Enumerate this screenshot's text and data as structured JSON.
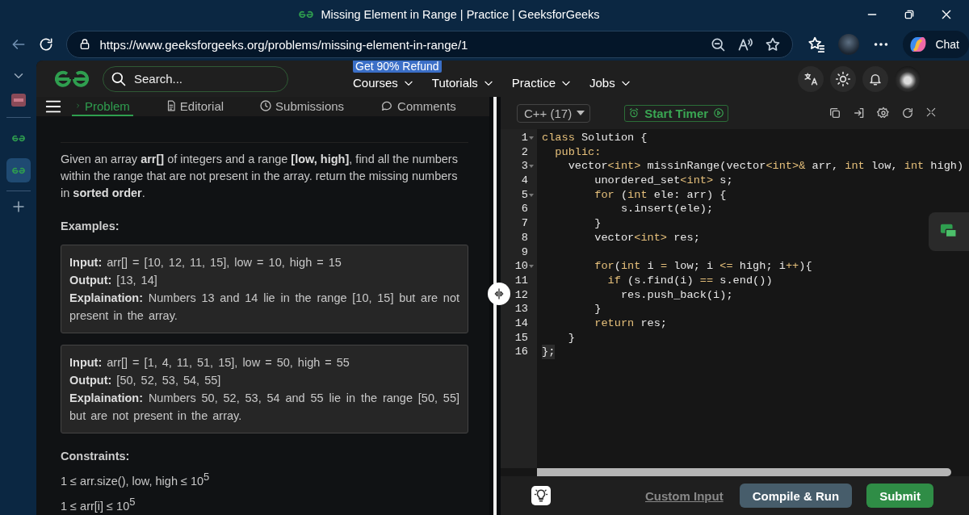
{
  "browser": {
    "tab_title": "Missing Element in Range | Practice | GeeksforGeeks",
    "url": "https://www.geeksforgeeks.org/problems/missing-element-in-range/1",
    "chat_label": "Chat"
  },
  "header": {
    "search_placeholder": "Search...",
    "promo_badge": "Get 90% Refund",
    "nav": [
      {
        "label": "Courses"
      },
      {
        "label": "Tutorials"
      },
      {
        "label": "Practice"
      },
      {
        "label": "Jobs"
      }
    ]
  },
  "problem_tabs": [
    {
      "label": "Problem",
      "selected": true
    },
    {
      "label": "Editorial",
      "selected": false
    },
    {
      "label": "Submissions",
      "selected": false
    },
    {
      "label": "Comments",
      "selected": false
    }
  ],
  "problem": {
    "description": "Given an array **arr[]** of integers and a range **[low, high]**, find all the numbers within the range that are not present in the array. return the missing numbers in **sorted order**.",
    "examples_heading": "Examples:",
    "examples": [
      {
        "lines": [
          "**Input:** arr[] = [10, 12, 11, 15], low = 10, high = 15",
          "**Output:** [13, 14]",
          "**Explaination:** Numbers 13 and 14 lie in the range [10, 15] but are not present in the array."
        ]
      },
      {
        "lines": [
          "**Input:** arr[] = [1, 4, 11, 51, 15], low = 50, high = 55",
          "**Output:** [50, 52, 53, 54, 55]",
          "**Explaination:** Numbers 50, 52, 53, 54 and 55 lie in the range [50, 55] but are not present in the array."
        ]
      }
    ],
    "constraints_heading": "Constraints:",
    "constraints": [
      "1 ≤ arr.size(), low, high ≤ 10$^{5}$",
      "1 ≤ arr[i] ≤ 10$^{5}$"
    ]
  },
  "editor": {
    "language": "C++ (17)",
    "timer_label": "Start Timer",
    "lines": [
      {
        "number": "1",
        "foldable": true,
        "active": false,
        "tokens": [
          {
            "text": "class",
            "kind": "keyword"
          },
          {
            "text": " Solution {",
            "kind": "plain"
          }
        ]
      },
      {
        "number": "2",
        "foldable": false,
        "active": false,
        "tokens": [
          {
            "text": "  public:",
            "kind": "keyword"
          }
        ]
      },
      {
        "number": "3",
        "foldable": true,
        "active": false,
        "tokens": [
          {
            "text": "    vector",
            "kind": "plain"
          },
          {
            "text": "<int>",
            "kind": "keyword"
          },
          {
            "text": " missinRange(vector",
            "kind": "plain"
          },
          {
            "text": "<int>&",
            "kind": "keyword"
          },
          {
            "text": " arr, ",
            "kind": "plain"
          },
          {
            "text": "int",
            "kind": "keyword"
          },
          {
            "text": " low, ",
            "kind": "plain"
          },
          {
            "text": "int",
            "kind": "keyword"
          },
          {
            "text": " high)",
            "kind": "plain"
          }
        ]
      },
      {
        "number": "4",
        "foldable": false,
        "active": false,
        "tokens": [
          {
            "text": "        unordered_set",
            "kind": "plain"
          },
          {
            "text": "<int>",
            "kind": "keyword"
          },
          {
            "text": " s;",
            "kind": "plain"
          }
        ]
      },
      {
        "number": "5",
        "foldable": true,
        "active": false,
        "tokens": [
          {
            "text": "        for",
            "kind": "keyword"
          },
          {
            "text": " (",
            "kind": "plain"
          },
          {
            "text": "int",
            "kind": "keyword"
          },
          {
            "text": " ele: arr) {",
            "kind": "plain"
          }
        ]
      },
      {
        "number": "6",
        "foldable": false,
        "active": false,
        "tokens": [
          {
            "text": "            s.insert(ele);",
            "kind": "plain"
          }
        ]
      },
      {
        "number": "7",
        "foldable": false,
        "active": false,
        "tokens": [
          {
            "text": "        }",
            "kind": "plain"
          }
        ]
      },
      {
        "number": "8",
        "foldable": false,
        "active": false,
        "tokens": [
          {
            "text": "        vector",
            "kind": "plain"
          },
          {
            "text": "<int>",
            "kind": "keyword"
          },
          {
            "text": " res;",
            "kind": "plain"
          }
        ]
      },
      {
        "number": "9",
        "foldable": false,
        "active": false
      },
      {
        "number": "10",
        "foldable": true,
        "active": false,
        "tokens": [
          {
            "text": "        for",
            "kind": "keyword"
          },
          {
            "text": "(",
            "kind": "plain"
          },
          {
            "text": "int",
            "kind": "keyword"
          },
          {
            "text": " i ",
            "kind": "plain"
          },
          {
            "text": "=",
            "kind": "keyword"
          },
          {
            "text": " low; i ",
            "kind": "plain"
          },
          {
            "text": "<=",
            "kind": "keyword"
          },
          {
            "text": " high; i",
            "kind": "plain"
          },
          {
            "text": "++",
            "kind": "keyword"
          },
          {
            "text": "){",
            "kind": "plain"
          }
        ]
      },
      {
        "number": "11",
        "foldable": false,
        "active": false,
        "tokens": [
          {
            "text": "          if",
            "kind": "keyword"
          },
          {
            "text": " (s.find(i) ",
            "kind": "plain"
          },
          {
            "text": "==",
            "kind": "keyword"
          },
          {
            "text": " s.end())",
            "kind": "plain"
          }
        ]
      },
      {
        "number": "12",
        "foldable": false,
        "active": false,
        "tokens": [
          {
            "text": "            res.push_back(i);",
            "kind": "plain"
          }
        ]
      },
      {
        "number": "13",
        "foldable": false,
        "active": false,
        "tokens": [
          {
            "text": "        }",
            "kind": "plain"
          }
        ]
      },
      {
        "number": "14",
        "foldable": false,
        "active": false,
        "tokens": [
          {
            "text": "        return",
            "kind": "keyword"
          },
          {
            "text": " res;",
            "kind": "plain"
          }
        ]
      },
      {
        "number": "15",
        "foldable": false,
        "active": false,
        "tokens": [
          {
            "text": "    }",
            "kind": "plain"
          }
        ]
      },
      {
        "number": "16",
        "foldable": false,
        "active": true,
        "tokens": [
          {
            "text": "};",
            "kind": "plain"
          }
        ]
      }
    ]
  },
  "actions": {
    "custom_input": "Custom Input",
    "compile": "Compile & Run",
    "submit": "Submit"
  }
}
